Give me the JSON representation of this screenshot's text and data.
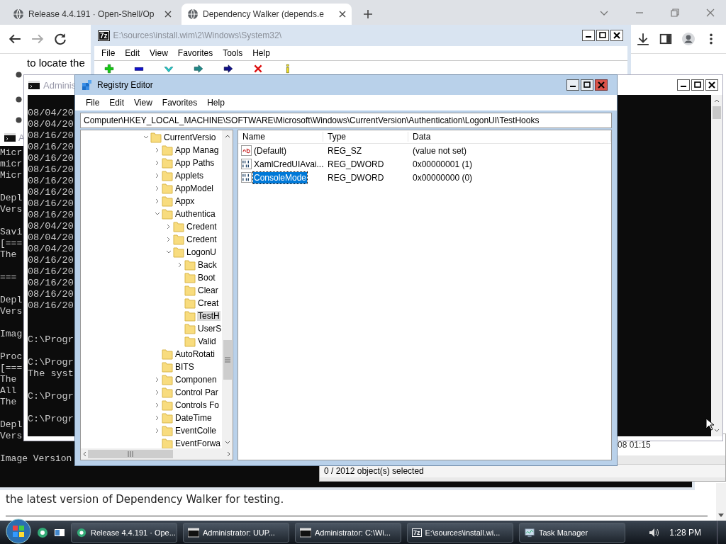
{
  "browser": {
    "tabs": [
      {
        "title": "Release 4.4.191 · Open-Shell/Op",
        "selected": false
      },
      {
        "title": "Dependency Walker (depends.e",
        "selected": true
      }
    ],
    "page": {
      "top_line": "to locate the",
      "closing": "the latest version of Dependency Walker for testing."
    }
  },
  "archive_window": {
    "badge": "7z",
    "title": "E:\\sources\\install.wim\\2\\Windows\\System32\\",
    "menu": [
      "File",
      "Edit",
      "View",
      "Favorites",
      "Tools",
      "Help"
    ],
    "list_cell": "08 01:15",
    "status": "0 / 2012 object(s) selected"
  },
  "console_back": {
    "title": "A",
    "blocks": [
      [
        "Micr",
        "micr",
        "Micr"
      ],
      [
        "Depl",
        "Vers"
      ],
      [
        "Savi",
        "[===",
        "The"
      ],
      [
        "==="
      ],
      [
        "Depl",
        "Vers"
      ],
      [
        "Imag"
      ],
      [
        "Proc",
        "[===",
        "The",
        "All",
        "The"
      ],
      [
        "Depl",
        "Vers"
      ],
      [
        "Image Version"
      ]
    ]
  },
  "console_front": {
    "title": "Adminis",
    "log_lines": [
      "08/04/20",
      "08/04/20",
      "08/16/20",
      "08/16/20",
      "08/16/20",
      "08/16/20",
      "08/16/20",
      "08/16/20",
      "08/16/20",
      "08/16/20",
      "08/04/20",
      "08/04/20",
      "08/04/20",
      "08/16/20",
      "08/16/20",
      "08/16/20",
      "08/16/20",
      "08/16/20"
    ],
    "prompt_blocks": [
      [
        "C:\\Progr"
      ],
      [
        "C:\\Progr",
        "The syst"
      ],
      [
        "C:\\Progr"
      ],
      [
        "C:\\Progr"
      ]
    ]
  },
  "registry": {
    "title": "Registry Editor",
    "menu": [
      "File",
      "Edit",
      "View",
      "Favorites",
      "Help"
    ],
    "address": "Computer\\HKEY_LOCAL_MACHINE\\SOFTWARE\\Microsoft\\Windows\\CurrentVersion\\Authentication\\LogonUI\\TestHooks",
    "tree": [
      {
        "label": "CurrentVersio",
        "expanded": true,
        "selected": false,
        "children": [
          {
            "label": "App Manag",
            "expanded": false,
            "selected": false
          },
          {
            "label": "App Paths",
            "expanded": false,
            "selected": false
          },
          {
            "label": "Applets",
            "expanded": false,
            "selected": false
          },
          {
            "label": "AppModel",
            "expanded": false,
            "selected": false
          },
          {
            "label": "Appx",
            "expanded": false,
            "selected": false
          },
          {
            "label": "Authentica",
            "expanded": true,
            "selected": false,
            "children": [
              {
                "label": "Credent",
                "expanded": false,
                "selected": false
              },
              {
                "label": "Credent",
                "expanded": false,
                "selected": false
              },
              {
                "label": "LogonU",
                "expanded": true,
                "selected": false,
                "children": [
                  {
                    "label": "Back",
                    "expanded": false,
                    "selected": false
                  },
                  {
                    "label": "Boot",
                    "selected": false
                  },
                  {
                    "label": "Clear",
                    "selected": false
                  },
                  {
                    "label": "Creat",
                    "selected": false
                  },
                  {
                    "label": "TestH",
                    "selected": true
                  },
                  {
                    "label": "UserS",
                    "selected": false
                  },
                  {
                    "label": "Valid",
                    "selected": false
                  }
                ]
              }
            ]
          },
          {
            "label": "AutoRotati",
            "selected": false
          },
          {
            "label": "BITS",
            "selected": false
          },
          {
            "label": "Componen",
            "expanded": false,
            "selected": false
          },
          {
            "label": "Control Par",
            "expanded": false,
            "selected": false
          },
          {
            "label": "Controls Fo",
            "expanded": false,
            "selected": false
          },
          {
            "label": "DateTime",
            "expanded": false,
            "selected": false
          },
          {
            "label": "EventColle",
            "expanded": false,
            "selected": false
          },
          {
            "label": "EventForwa",
            "selected": false
          }
        ]
      }
    ],
    "columns": [
      "Name",
      "Type",
      "Data"
    ],
    "values": [
      {
        "kind": "string",
        "name": "(Default)",
        "type": "REG_SZ",
        "data": "(value not set)",
        "selected": false
      },
      {
        "kind": "dword",
        "name": "XamlCredUIAvai...",
        "type": "REG_DWORD",
        "data": "0x00000001 (1)",
        "selected": false
      },
      {
        "kind": "dword",
        "name": "ConsoleMode",
        "type": "REG_DWORD",
        "data": "0x00000000 (0)",
        "selected": true
      }
    ]
  },
  "taskbar": {
    "tasks": [
      {
        "kind": "browser",
        "label": "Release 4.4.191 · Ope..."
      },
      {
        "kind": "console",
        "label": "Administrator:  UUP..."
      },
      {
        "kind": "console",
        "label": "Administrator: C:\\Wi..."
      },
      {
        "kind": "archive",
        "label": "E:\\sources\\install.wi...",
        "badge": "7z"
      },
      {
        "kind": "taskmgr",
        "label": "Task Manager"
      }
    ],
    "clock": "1:28 PM"
  }
}
